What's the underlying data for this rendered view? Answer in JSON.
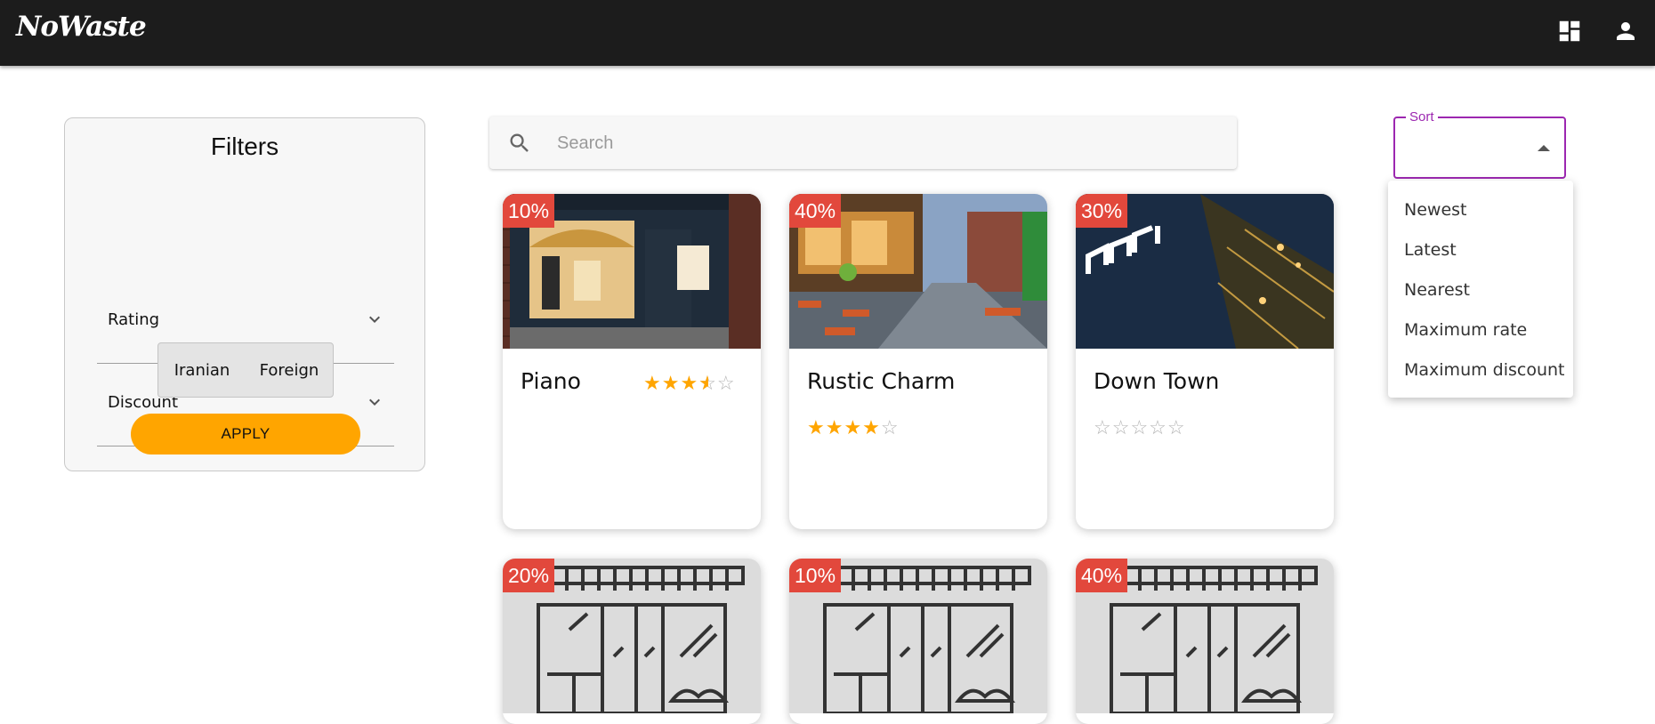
{
  "app": {
    "logo": "NoWaste"
  },
  "header": {
    "icons": [
      "dashboard-icon",
      "user-icon"
    ]
  },
  "filters": {
    "title": "Filters",
    "rating_label": "Rating",
    "discount_label": "Discount",
    "toggle": [
      "Iranian",
      "Foreign"
    ],
    "apply_label": "APPLY"
  },
  "search": {
    "placeholder": "Search"
  },
  "sort": {
    "label": "Sort",
    "value": "",
    "options": [
      "Newest",
      "Latest",
      "Nearest",
      "Maximum rate",
      "Maximum discount"
    ]
  },
  "restaurants": [
    {
      "name": "Piano",
      "discount": "10%",
      "rating": 3.5,
      "image": "photo-storefront"
    },
    {
      "name": "Rustic Charm",
      "discount": "40%",
      "rating": 4,
      "image": "photo-patio"
    },
    {
      "name": "Down Town",
      "discount": "30%",
      "rating": 0,
      "image": "photo-night-sign"
    },
    {
      "name": "",
      "discount": "20%",
      "rating": null,
      "image": "placeholder-storefront"
    },
    {
      "name": "",
      "discount": "10%",
      "rating": null,
      "image": "placeholder-storefront"
    },
    {
      "name": "",
      "discount": "40%",
      "rating": null,
      "image": "placeholder-storefront"
    }
  ],
  "colors": {
    "accent": "#ffa500",
    "discount_badge": "#e2483c",
    "sort_focus": "#9c27b0",
    "topbar": "#1c1c1c"
  }
}
